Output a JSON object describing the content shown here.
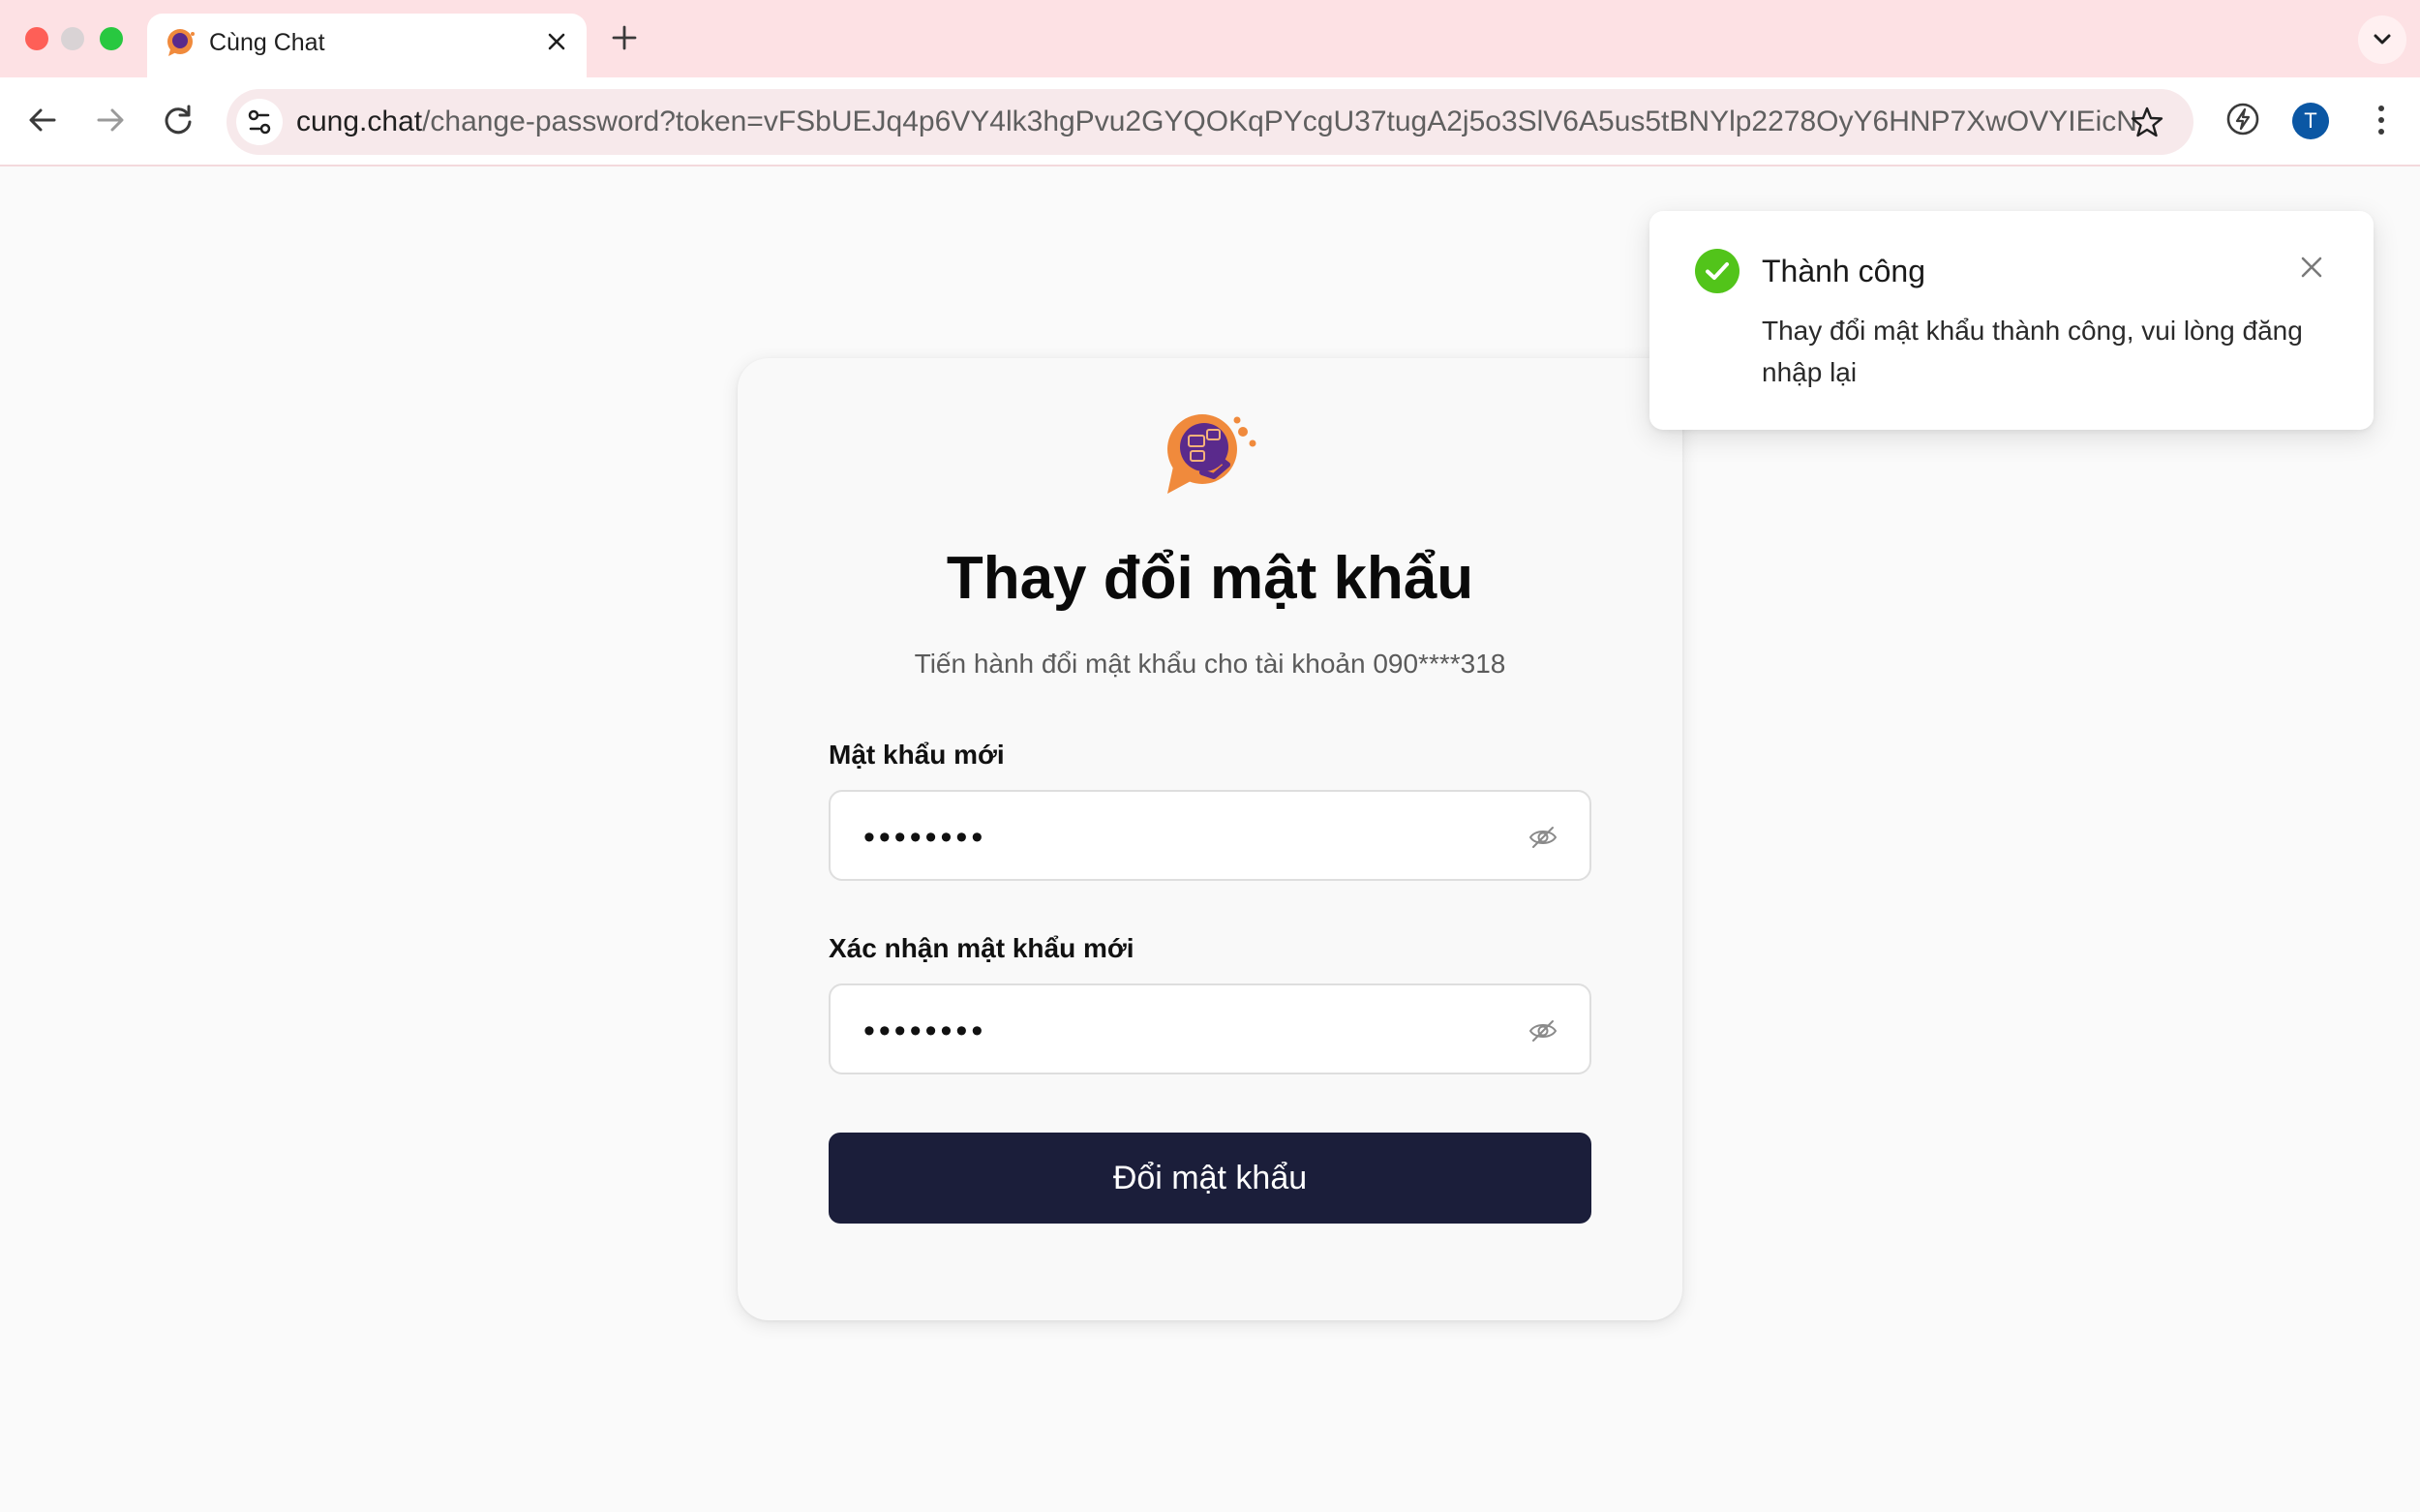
{
  "browser": {
    "tab_title": "Cùng Chat",
    "url_host": "cung.chat",
    "url_path": "/change-password?token=vFSbUEJq4p6VY4lk3hgPvu2GYQOKqPYcgU37tugA2j5o3SlV6A5us5tBNYlp2278OyY6HNP7XwOVYIEicNm...",
    "profile_initial": "T",
    "icons": {
      "back": "arrow-left-icon",
      "forward": "arrow-right-icon",
      "reload": "reload-icon",
      "site_info": "tune-icon",
      "bookmark": "star-icon",
      "extension": "lightning-icon",
      "menu": "more-vertical-icon"
    }
  },
  "page": {
    "title": "Thay đổi mật khẩu",
    "subtitle": "Tiến hành đổi mật khẩu cho tài khoản 090****318",
    "fields": [
      {
        "label": "Mật khẩu mới",
        "value": "••••••••"
      },
      {
        "label": "Xác nhận mật khẩu mới",
        "value": "••••••••"
      }
    ],
    "submit_label": "Đổi mật khẩu"
  },
  "toast": {
    "title": "Thành công",
    "message": "Thay đổi mật khẩu thành công, vui lòng đăng nhập lại",
    "status_color": "#52c41a"
  },
  "colors": {
    "tabbar": "#fde1e4",
    "button": "#1b1e3a",
    "logo_orange": "#f08a3c",
    "logo_purple": "#5a2a8c"
  }
}
